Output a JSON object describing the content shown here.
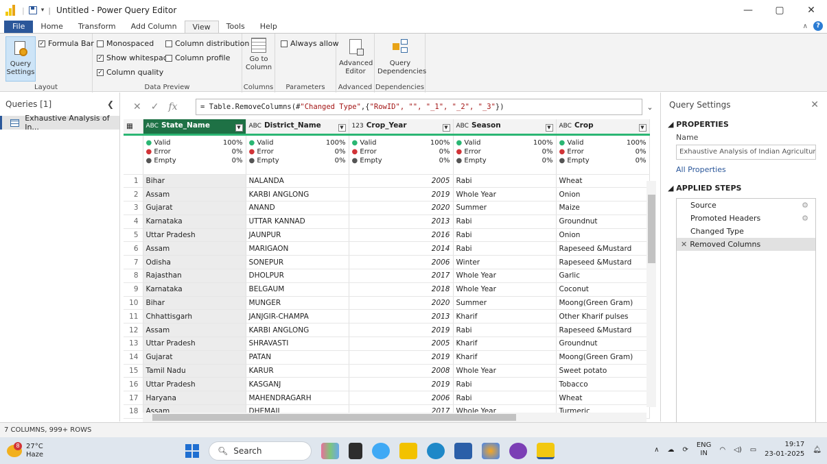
{
  "window": {
    "title": "Untitled - Power Query Editor",
    "minimize": "—",
    "restore": "▢",
    "close": "✕"
  },
  "tabs": [
    "File",
    "Home",
    "Transform",
    "Add Column",
    "View",
    "Tools",
    "Help"
  ],
  "active_tab": "View",
  "ribbon": {
    "layout": {
      "query_settings": "Query Settings",
      "formula_bar": "Formula Bar",
      "label": "Layout"
    },
    "data_preview": {
      "monospaced": "Monospaced",
      "show_whitespace": "Show whitespace",
      "column_quality": "Column quality",
      "column_distribution": "Column distribution",
      "column_profile": "Column profile",
      "label": "Data Preview"
    },
    "columns": {
      "go_to_column": "Go to Column",
      "label": "Columns"
    },
    "parameters": {
      "always_allow": "Always allow",
      "label": "Parameters"
    },
    "advanced": {
      "advanced_editor": "Advanced Editor",
      "label": "Advanced"
    },
    "dependencies": {
      "query_dependencies": "Query Dependencies",
      "label": "Dependencies"
    }
  },
  "queries": {
    "title": "Queries [1]",
    "items": [
      "Exhaustive Analysis of In..."
    ]
  },
  "formula": {
    "prefix": "= Table.RemoveColumns(#",
    "s1": "\"Changed Type\"",
    "mid": ",{",
    "s2": "\"RowID\", \"\", \"_1\", \"_2\", \"_3\"",
    "suffix": "})"
  },
  "columns": [
    {
      "type": "ABC",
      "name": "State_Name"
    },
    {
      "type": "ABC",
      "name": "District_Name"
    },
    {
      "type": "123",
      "name": "Crop_Year"
    },
    {
      "type": "ABC",
      "name": "Season"
    },
    {
      "type": "ABC",
      "name": "Crop"
    }
  ],
  "quality": {
    "valid": "Valid",
    "error": "Error",
    "empty": "Empty",
    "valid_pct": "100%",
    "error_pct": "0%",
    "empty_pct": "0%"
  },
  "rows": [
    [
      "1",
      "Bihar",
      "NALANDA",
      "2005",
      "Rabi",
      "Wheat"
    ],
    [
      "2",
      "Assam",
      "KARBI ANGLONG",
      "2019",
      "Whole Year",
      "Onion"
    ],
    [
      "3",
      "Gujarat",
      "ANAND",
      "2020",
      "Summer",
      "Maize"
    ],
    [
      "4",
      "Karnataka",
      "UTTAR KANNAD",
      "2013",
      "Rabi",
      "Groundnut"
    ],
    [
      "5",
      "Uttar Pradesh",
      "JAUNPUR",
      "2016",
      "Rabi",
      "Onion"
    ],
    [
      "6",
      "Assam",
      "MARIGAON",
      "2014",
      "Rabi",
      "Rapeseed &Mustard"
    ],
    [
      "7",
      "Odisha",
      "SONEPUR",
      "2006",
      "Winter",
      "Rapeseed &Mustard"
    ],
    [
      "8",
      "Rajasthan",
      "DHOLPUR",
      "2017",
      "Whole Year",
      "Garlic"
    ],
    [
      "9",
      "Karnataka",
      "BELGAUM",
      "2018",
      "Whole Year",
      "Coconut"
    ],
    [
      "10",
      "Bihar",
      "MUNGER",
      "2020",
      "Summer",
      "Moong(Green Gram)"
    ],
    [
      "11",
      "Chhattisgarh",
      "JANJGIR-CHAMPA",
      "2013",
      "Kharif",
      "Other Kharif pulses"
    ],
    [
      "12",
      "Assam",
      "KARBI ANGLONG",
      "2019",
      "Rabi",
      "Rapeseed &Mustard"
    ],
    [
      "13",
      "Uttar Pradesh",
      "SHRAVASTI",
      "2005",
      "Kharif",
      "Groundnut"
    ],
    [
      "14",
      "Gujarat",
      "PATAN",
      "2019",
      "Kharif",
      "Moong(Green Gram)"
    ],
    [
      "15",
      "Tamil Nadu",
      "KARUR",
      "2008",
      "Whole Year",
      "Sweet potato"
    ],
    [
      "16",
      "Uttar Pradesh",
      "KASGANJ",
      "2019",
      "Rabi",
      "Tobacco"
    ],
    [
      "17",
      "Haryana",
      "MAHENDRAGARH",
      "2006",
      "Rabi",
      "Wheat"
    ],
    [
      "18",
      "Assam",
      "DHEMAJI",
      "2017",
      "Whole Year",
      "Turmeric"
    ]
  ],
  "settings": {
    "title": "Query Settings",
    "properties": "PROPERTIES",
    "name_label": "Name",
    "name_value": "Exhaustive Analysis of Indian Agriculture",
    "all_properties": "All Properties",
    "applied_steps": "APPLIED STEPS",
    "steps": [
      "Source",
      "Promoted Headers",
      "Changed Type",
      "Removed Columns"
    ]
  },
  "status": "7 COLUMNS, 999+ ROWS",
  "taskbar": {
    "temp": "27°C",
    "weather": "Haze",
    "badge": "8",
    "search": "Search",
    "lang1": "ENG",
    "lang2": "IN",
    "time": "19:17",
    "date": "23-01-2025"
  },
  "colors": {
    "accent": "#2b579a",
    "selected_header": "#1e7145",
    "quality_bar": "#2bb673",
    "error": "#d13438"
  }
}
